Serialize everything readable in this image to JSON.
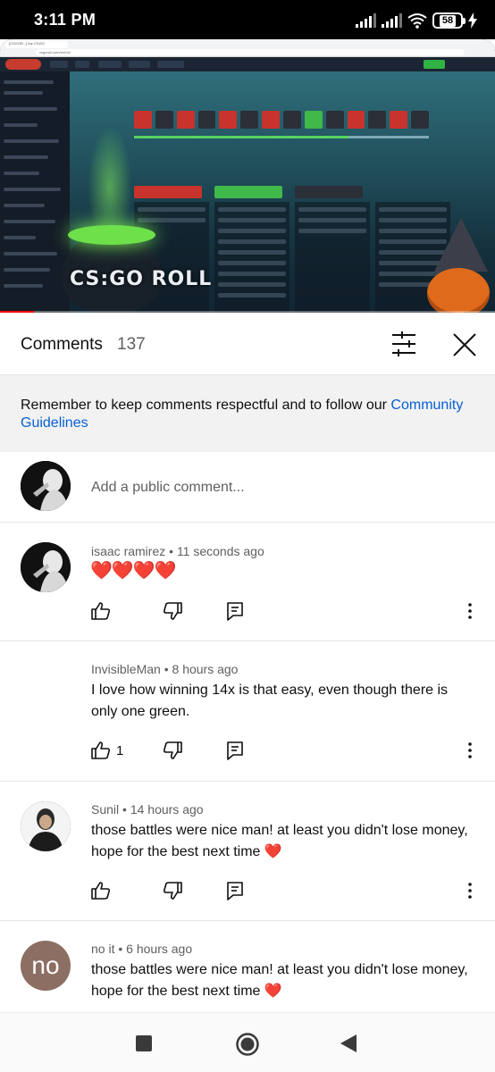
{
  "status_bar": {
    "time": "3:11 PM",
    "battery": "58"
  },
  "video": {
    "browser_tab": "[CSGOR...] the CSGO",
    "url": "csgoroll.com/en/roll",
    "logo_text": "CS:GO ROLL"
  },
  "comments_panel": {
    "title": "Comments",
    "count": "137",
    "guidelines_text": "Remember to keep comments respectful and to follow our ",
    "guidelines_link": "Community Guidelines",
    "add_comment_placeholder": "Add a public comment..."
  },
  "comments": [
    {
      "author": "isaac ramirez",
      "time": "11 seconds ago",
      "text": "❤️❤️❤️❤️",
      "likes": ""
    },
    {
      "author": "InvisibleMan",
      "time": "8 hours ago",
      "text": "I love how winning 14x is that easy, even though there is only one green.",
      "likes": "1"
    },
    {
      "author": "Sunil",
      "time": "14 hours ago",
      "text": "those battles were nice man! at least you didn't lose money, hope for the best next time",
      "likes": ""
    },
    {
      "author": "no it",
      "avatar_letters": "no",
      "time": "6 hours ago",
      "text": "those battles were nice man! at least you didn't lose money, hope for the best next time",
      "likes": ""
    }
  ],
  "meta_separator": " • ",
  "icons": {
    "filter": "tune-icon",
    "close": "close-icon",
    "like": "thumbs-up-icon",
    "dislike": "thumbs-down-icon",
    "reply": "reply-icon",
    "more": "more-vert-icon",
    "heart": "heart-emoji"
  },
  "colors": {
    "link": "#065fd4",
    "heart": "#d1232a",
    "banner_bg": "#f2f2f2"
  }
}
